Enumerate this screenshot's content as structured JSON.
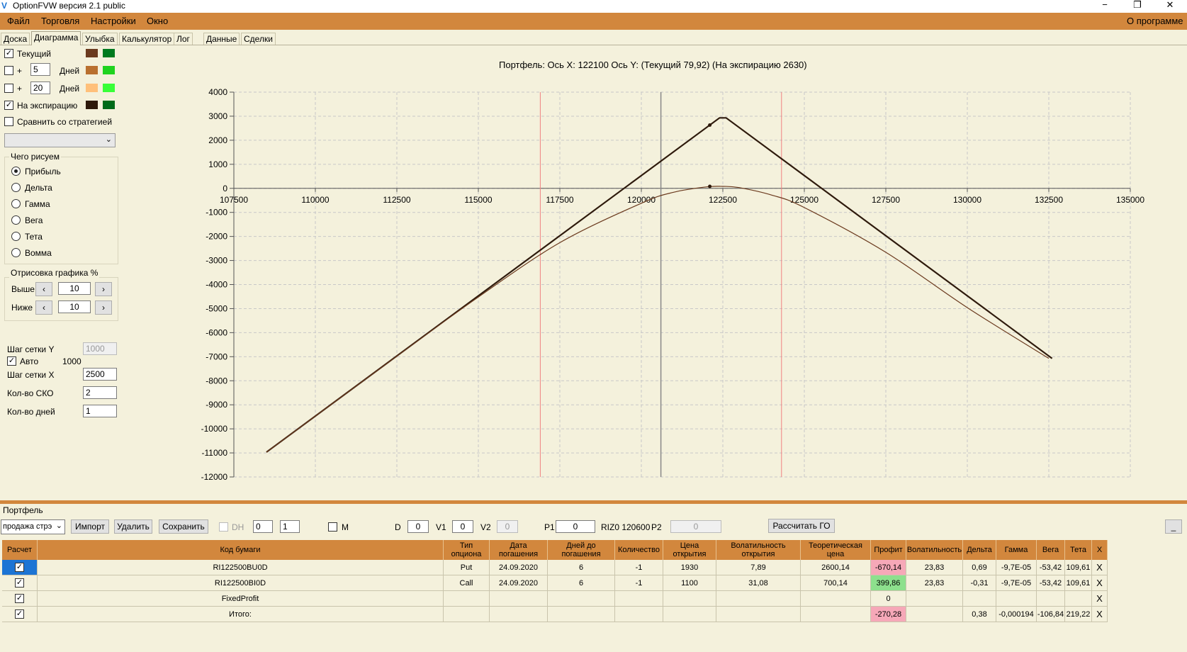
{
  "window": {
    "title": "OptionFVW версия 2.1 public",
    "minimize": "−",
    "restore": "❐",
    "close": "✕"
  },
  "menu": {
    "items": [
      "Файл",
      "Торговля",
      "Настройки",
      "Окно"
    ],
    "about": "О программе"
  },
  "tabs": [
    "Доска",
    "Диаграмма",
    "Улыбка",
    "Калькулятор",
    "Лог",
    "Данные",
    "Сделки"
  ],
  "active_tab": "Диаграмма",
  "left_panel": {
    "current_label": "Текущий",
    "current_checked": true,
    "plus1_sign": "+",
    "plus1_days": "5",
    "plus1_checked": false,
    "days_label": "Дней",
    "plus2_sign": "+",
    "plus2_days": "20",
    "plus2_checked": false,
    "expiry_label": "На экспирацию",
    "expiry_checked": true,
    "compare_label": "Сравнить со стратегией",
    "compare_checked": false,
    "colors": {
      "current_a": "#6b3a1e",
      "current_b": "#007a1e",
      "plus1_a": "#b9702f",
      "plus1_b": "#1fd31f",
      "plus2_a": "#ffc07a",
      "plus2_b": "#38ff38",
      "expiry_a": "#2e1a0c",
      "expiry_b": "#006b1a"
    },
    "draw_group": {
      "title": "Чего рисуем",
      "options": [
        "Прибыль",
        "Дельта",
        "Гамма",
        "Вега",
        "Тета",
        "Вомма"
      ],
      "selected": "Прибыль"
    },
    "range_group": {
      "title": "Отрисовка графика %",
      "above_label": "Выше",
      "above_value": "10",
      "below_label": "Ниже",
      "below_value": "10",
      "prev": "‹",
      "next": "›"
    },
    "grid_y_label": "Шаг сетки Y",
    "grid_y_value": "1000",
    "auto_label": "Авто",
    "auto_checked": true,
    "auto_value": "1000",
    "grid_x_label": "Шаг сетки X",
    "grid_x_value": "2500",
    "sko_label": "Кол-во СКО",
    "sko_value": "2",
    "days_count_label": "Кол-во дней",
    "days_count_value": "1"
  },
  "chart_data": {
    "type": "line",
    "title": "Портфель:  Ось X:  122100 Ось Y:   (Текущий 79,92)  (На экспирацию 2630)",
    "xlim": [
      107500,
      135000
    ],
    "ylim": [
      -12000,
      4000
    ],
    "x_ticks": [
      107500,
      110000,
      112500,
      115000,
      117500,
      120000,
      122500,
      125000,
      127500,
      130000,
      132500,
      135000
    ],
    "y_ticks": [
      4000,
      3000,
      2000,
      1000,
      0,
      -1000,
      -2000,
      -3000,
      -4000,
      -5000,
      -6000,
      -7000,
      -8000,
      -9000,
      -10000,
      -11000,
      -12000
    ],
    "grid": true,
    "cursor_x": 120600,
    "sd_lines_x": [
      116900,
      124300
    ],
    "series": [
      {
        "name": "На экспирацию",
        "color": "#2e1a0c",
        "x": [
          108500,
          122400,
          122600,
          132600
        ],
        "y": [
          -10970,
          2930,
          2930,
          -7070
        ]
      },
      {
        "name": "Текущий",
        "color": "#6b3a1e",
        "x": [
          108500,
          110000,
          112500,
          115000,
          117500,
          120000,
          121000,
          122000,
          122500,
          123000,
          124000,
          125000,
          127500,
          130000,
          132500
        ],
        "y": [
          -10970,
          -9470,
          -6980,
          -4520,
          -2260,
          -620,
          -160,
          60,
          80,
          30,
          -280,
          -800,
          -2660,
          -4960,
          -7070
        ]
      }
    ],
    "markers": [
      {
        "x": 122100,
        "y": 2630
      },
      {
        "x": 122100,
        "y": 80
      }
    ]
  },
  "portfolio": {
    "title": "Портфель",
    "strategy_select": "продажа стрэ",
    "import": "Импорт",
    "delete": "Удалить",
    "save": "Сохранить",
    "dh_label": "DH",
    "spin1": "0",
    "spin2": "1",
    "m_label": "M",
    "d_label": "D",
    "d_value": "0",
    "v1_label": "V1",
    "v1_value": "0",
    "v2_label": "V2",
    "v2_value": "0",
    "p1_label": "P1",
    "p1_value": "0",
    "instrument": "RIZ0 120600",
    "p2_label": "P2",
    "p2_value": "0",
    "calc_go": "Рассчитать ГО",
    "min_button": "_"
  },
  "table": {
    "headers": [
      "Расчет",
      "Код бумаги",
      "Тип опциона",
      "Дата погашения",
      "Дней до погашения",
      "Количество",
      "Цена открытия",
      "Волатильность открытия",
      "Теоретическая цена",
      "Профит",
      "Волатильность",
      "Дельта",
      "Гамма",
      "Вега",
      "Тета",
      "X"
    ],
    "rows": [
      [
        "✓",
        "RI122500BU0D",
        "Put",
        "24.09.2020",
        "6",
        "-1",
        "1930",
        "7,89",
        "2600,14",
        "-670,14",
        "23,83",
        "0,69",
        "-9,7E-05",
        "-53,42",
        "109,61",
        "X"
      ],
      [
        "✓",
        "RI122500BI0D",
        "Call",
        "24.09.2020",
        "6",
        "-1",
        "1100",
        "31,08",
        "700,14",
        "399,86",
        "23,83",
        "-0,31",
        "-9,7E-05",
        "-53,42",
        "109,61",
        "X"
      ],
      [
        "✓",
        "FixedProfit",
        "",
        "",
        "",
        "",
        "",
        "",
        "",
        "0",
        "",
        "",
        "",
        "",
        "",
        "X"
      ],
      [
        "✓",
        "Итого:",
        "",
        "",
        "",
        "",
        "",
        "",
        "",
        "-270,28",
        "",
        "0,38",
        "-0,000194",
        "-106,84",
        "219,22",
        "X"
      ]
    ]
  }
}
